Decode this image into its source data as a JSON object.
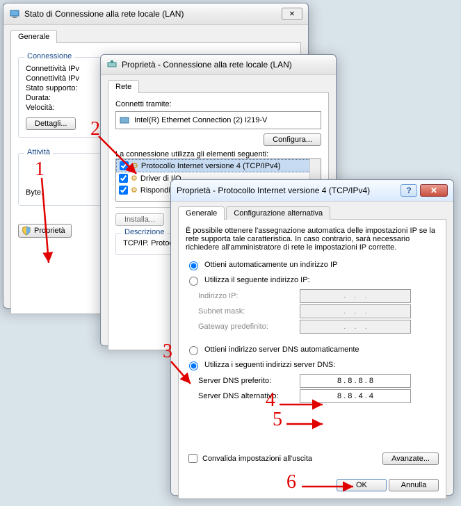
{
  "win1": {
    "title": "Stato di Connessione alla rete locale (LAN)",
    "tab": "Generale",
    "groupConnection": "Connessione",
    "rows": {
      "ipv4": "Connettività IPv",
      "ipv6": "Connettività IPv",
      "state": "Stato supporto:",
      "duration": "Durata:",
      "speed": "Velocità:"
    },
    "detailsButton": "Dettagli...",
    "groupActivity": "Attività",
    "bytes": "Byte:",
    "propertiesButton": "Proprietà"
  },
  "win2": {
    "title": "Proprietà - Connessione alla rete locale (LAN)",
    "tab": "Rete",
    "connectVia": "Connetti tramite:",
    "adapter": "Intel(R) Ethernet Connection (2) I219-V",
    "configureButton": "Configura...",
    "elementsText": "La connessione utilizza gli elementi seguenti:",
    "items": [
      "Protocollo Internet versione 4 (TCP/IPv4)",
      "Driver di I/O",
      "Risponditore"
    ],
    "installButton": "Installa...",
    "descTitle": "Descrizione",
    "descText": "TCP/IP. Protocollo comunicazione tra"
  },
  "win3": {
    "title": "Proprietà - Protocollo Internet versione 4 (TCP/IPv4)",
    "tabMain": "Generale",
    "tabAlt": "Configurazione alternativa",
    "intro": "È possibile ottenere l'assegnazione automatica delle impostazioni IP se la rete supporta tale caratteristica. In caso contrario, sarà necessario richiedere all'amministratore di rete le impostazioni IP corrette.",
    "radioIpAuto": "Ottieni automaticamente un indirizzo IP",
    "radioIpManual": "Utilizza il seguente indirizzo IP:",
    "ipLabel": "Indirizzo IP:",
    "maskLabel": "Subnet mask:",
    "gwLabel": "Gateway predefinito:",
    "radioDnsAuto": "Ottieni indirizzo server DNS automaticamente",
    "radioDnsManual": "Utilizza i seguenti indirizzi server DNS:",
    "dnsPrefLabel": "Server DNS preferito:",
    "dnsAltLabel": "Server DNS alternativo:",
    "dnsPref": "8 . 8 . 8 . 8",
    "dnsAlt": "8 . 8 . 4 . 4",
    "validateCheckbox": "Convalida impostazioni all'uscita",
    "advancedButton": "Avanzate...",
    "okButton": "OK",
    "cancelButton": "Annulla"
  },
  "annotations": {
    "n1": "1",
    "n2": "2",
    "n3": "3",
    "n4": "4",
    "n5": "5",
    "n6": "6"
  }
}
